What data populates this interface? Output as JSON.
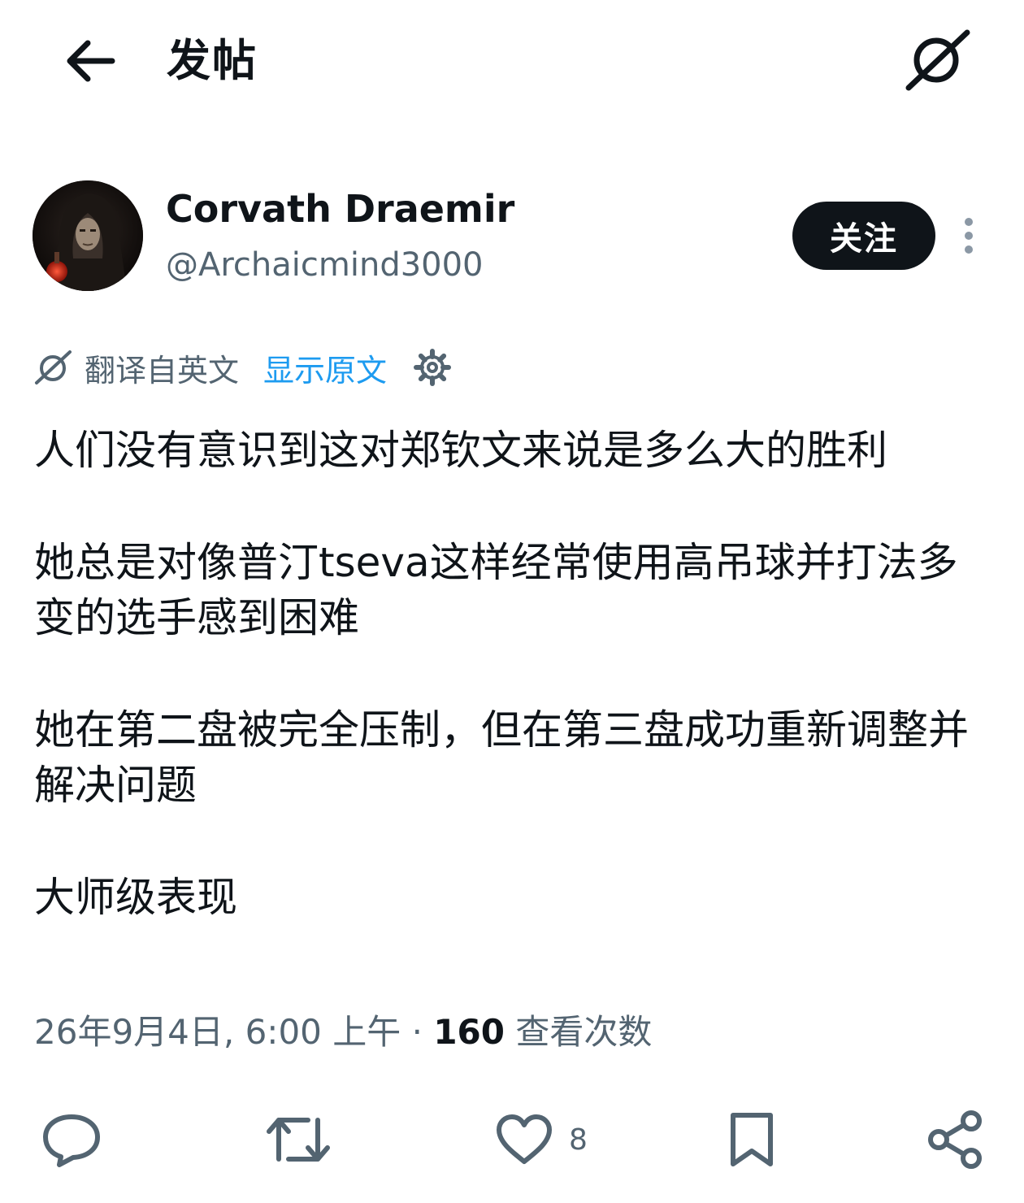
{
  "header": {
    "title": "发帖",
    "back_icon": "arrow-left-icon",
    "grok_icon": "grok-icon"
  },
  "author": {
    "name": "Corvath Draemir",
    "handle": "@Archaicmind3000",
    "follow_label": "关注",
    "more_icon": "more-vertical-icon"
  },
  "translation": {
    "label": "翻译自英文",
    "show_original": "显示原文",
    "settings_icon": "gear-icon"
  },
  "post": {
    "paragraphs": [
      "人们没有意识到这对郑钦文来说是多么大的胜利",
      "她总是对像普汀tseva这样经常使用高吊球并打法多变的选手感到困难",
      "她在第二盘被完全压制，但在第三盘成功重新调整并解决问题",
      "大师级表现"
    ]
  },
  "meta": {
    "date_time": "26年9月4日, 6:00 上午",
    "separator": " · ",
    "views_count": "160",
    "views_label": "查看次数"
  },
  "actions": {
    "like_count": "8",
    "icons": [
      "reply-icon",
      "retweet-icon",
      "heart-icon",
      "bookmark-icon",
      "share-icon"
    ]
  },
  "colors": {
    "text_primary": "#0f1419",
    "text_secondary": "#536471",
    "link_blue": "#1d9bf0",
    "button_dark": "#0f1419"
  }
}
